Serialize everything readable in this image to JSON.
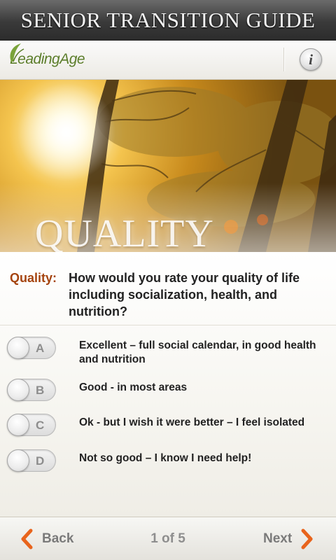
{
  "header": {
    "title": "SENIOR TRANSITION GUIDE"
  },
  "brand": {
    "logo_text": "LeadingAge",
    "info_label": "i"
  },
  "hero": {
    "title": "QUALITY"
  },
  "question": {
    "label": "Quality:",
    "text": "How would you rate your quality of life including socialization, health, and nutrition?"
  },
  "options": [
    {
      "letter": "A",
      "text": "Excellent – full social calendar, in good health and nutrition"
    },
    {
      "letter": "B",
      "text": "Good - in most areas"
    },
    {
      "letter": "C",
      "text": "Ok - but I wish it were better – I feel isolated"
    },
    {
      "letter": "D",
      "text": "Not so good – I know I need help!"
    }
  ],
  "footer": {
    "back_label": "Back",
    "next_label": "Next",
    "page_indicator": "1 of 5"
  },
  "colors": {
    "accent": "#e8641c",
    "question_label": "#a5440f",
    "logo_green": "#5b7d2a"
  },
  "icons": {
    "info": "info-icon",
    "back": "chevron-left-icon",
    "next": "chevron-right-icon"
  }
}
